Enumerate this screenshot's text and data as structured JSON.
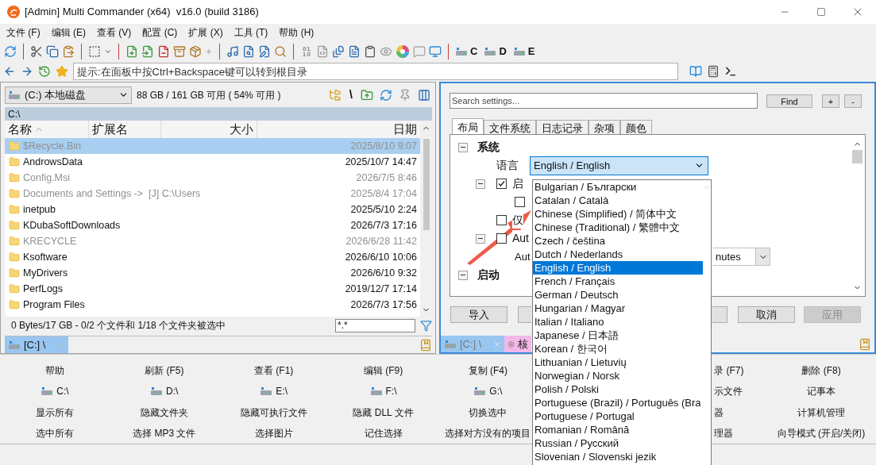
{
  "window": {
    "title": "[Admin] Multi Commander (x64)  v16.0 (build 3186)"
  },
  "menu": [
    "文件 (F)",
    "编辑 (E)",
    "查看 (V)",
    "配置 (C)",
    "扩展 (X)",
    "工具 (T)",
    "帮助 (H)"
  ],
  "toolbar_drives": [
    "C",
    "D",
    "E"
  ],
  "address": {
    "placeholder": "提示:在面板中按Ctrl+Backspace键可以转到根目录"
  },
  "left_panel": {
    "drive": "(C:) 本地磁盘",
    "space": "88 GB / 161 GB 可用 ( 54% 可用 )",
    "root_button": "\\",
    "path": "C:\\",
    "columns": [
      "名称",
      "扩展名",
      "大小",
      "日期"
    ],
    "rows": [
      {
        "name": "$Recycle.Bin",
        "date": "2025/8/10 9:07",
        "hidden": true,
        "selected": true
      },
      {
        "name": "AndrowsData",
        "date": "2025/10/7 14:47",
        "hidden": false,
        "selected": false
      },
      {
        "name": "Config.Msi",
        "date": "2026/7/5 8:46",
        "hidden": true,
        "selected": false
      },
      {
        "name": "Documents and Settings ->  [J] C:\\Users",
        "date": "2025/8/4 17:04",
        "hidden": true,
        "selected": false
      },
      {
        "name": "inetpub",
        "date": "2025/5/10 2:24",
        "hidden": false,
        "selected": false
      },
      {
        "name": "KDubaSoftDownloads",
        "date": "2026/7/3 17:16",
        "hidden": false,
        "selected": false
      },
      {
        "name": "KRECYCLE",
        "date": "2026/6/28 11:42",
        "hidden": true,
        "selected": false
      },
      {
        "name": "Ksoftware",
        "date": "2026/6/10 10:06",
        "hidden": false,
        "selected": false
      },
      {
        "name": "MyDrivers",
        "date": "2026/6/10 9:32",
        "hidden": false,
        "selected": false
      },
      {
        "name": "PerfLogs",
        "date": "2019/12/7 17:14",
        "hidden": false,
        "selected": false
      },
      {
        "name": "Program Files",
        "date": "2026/7/3 17:56",
        "hidden": false,
        "selected": false
      }
    ],
    "status": "0 Bytes/17 GB - 0/2 个文件和 1/18 个文件夹被选中",
    "filter": "*.*",
    "tabs": [
      {
        "label": "[C:] \\",
        "selected": true
      }
    ]
  },
  "settings": {
    "search_placeholder": "Search settings...",
    "find": "Find",
    "expand_all": "+",
    "collapse_all": "-",
    "tabs": [
      {
        "label": "布局",
        "selected": true
      },
      {
        "label": "文件系统",
        "selected": false
      },
      {
        "label": "日志记录",
        "selected": false
      },
      {
        "label": "杂项",
        "selected": false
      },
      {
        "label": "颜色",
        "selected": false
      }
    ],
    "tree": [
      {
        "label": "系统",
        "expanded": true,
        "children": [
          {
            "kind": "combo",
            "label": "语言",
            "value": "English / English",
            "open": true,
            "options": [
              {
                "label": "Bulgarian / Български",
                "selected": false
              },
              {
                "label": "Catalan / Català",
                "selected": false
              },
              {
                "label": "Chinese (Simplified) / 简体中文",
                "selected": false
              },
              {
                "label": "Chinese (Traditional) / 繁體中文",
                "selected": false
              },
              {
                "label": "Czech / čeština",
                "selected": false
              },
              {
                "label": "Dutch / Nederlands",
                "selected": false
              },
              {
                "label": "English / English",
                "selected": true
              },
              {
                "label": "French / Français",
                "selected": false
              },
              {
                "label": "German / Deutsch",
                "selected": false
              },
              {
                "label": "Hungarian / Magyar",
                "selected": false
              },
              {
                "label": "Italian / Italiano",
                "selected": false
              },
              {
                "label": "Japanese / 日本語",
                "selected": false
              },
              {
                "label": "Korean / 한국어",
                "selected": false
              },
              {
                "label": "Lithuanian / Lietuvių",
                "selected": false
              },
              {
                "label": "Norwegian / Norsk",
                "selected": false
              },
              {
                "label": "Polish / Polski",
                "selected": false
              },
              {
                "label": "Portuguese (Brazil) / Português (Bra",
                "selected": false
              },
              {
                "label": "Portuguese / Portugal",
                "selected": false
              },
              {
                "label": "Romanian / Română",
                "selected": false
              },
              {
                "label": "Russian / Русский",
                "selected": false
              },
              {
                "label": "Slovenian / Slovenski jezik",
                "selected": false
              }
            ]
          },
          {
            "kind": "check",
            "label": "启",
            "checked": true,
            "expanded": true,
            "children": [
              {
                "kind": "check",
                "checked": false
              }
            ]
          },
          {
            "kind": "check",
            "label": "仅",
            "checked": false
          },
          {
            "kind": "check",
            "label": "Aut",
            "checked": false,
            "expanded": true,
            "children": [
              {
                "kind": "select",
                "label": "Aut",
                "value": "nutes"
              }
            ]
          }
        ]
      },
      {
        "label": "启动",
        "expanded": true
      }
    ],
    "buttons": [
      {
        "label": "导入",
        "disabled": false
      },
      {
        "label": "取消",
        "disabled": false
      },
      {
        "label": "应用",
        "disabled": true
      }
    ],
    "tabs_bottom": [
      {
        "label": "[C:] \\",
        "kind": "drive",
        "selected": false
      },
      {
        "label": "核",
        "kind": "settings",
        "selected": true
      }
    ]
  },
  "button_grid": [
    [
      {
        "label": "帮助",
        "kind": "text"
      },
      {
        "label": "C:\\",
        "kind": "drive"
      },
      {
        "label": "显示所有",
        "kind": "text"
      },
      {
        "label": "选中所有",
        "kind": "text"
      }
    ],
    [
      {
        "label": "刷新 (F5)",
        "kind": "text"
      },
      {
        "label": "D:\\",
        "kind": "drive"
      },
      {
        "label": "隐藏文件夹",
        "kind": "text"
      },
      {
        "label": "选择 MP3 文件",
        "kind": "text"
      }
    ],
    [
      {
        "label": "查看 (F1)",
        "kind": "text"
      },
      {
        "label": "E:\\",
        "kind": "drive"
      },
      {
        "label": "隐藏可执行文件",
        "kind": "text"
      },
      {
        "label": "选择图片",
        "kind": "text"
      }
    ],
    [
      {
        "label": "编辑 (F9)",
        "kind": "text"
      },
      {
        "label": "F:\\",
        "kind": "drive"
      },
      {
        "label": "隐藏 DLL 文件",
        "kind": "text"
      },
      {
        "label": "记住选择",
        "kind": "text"
      }
    ],
    [
      {
        "label": "复制 (F4)",
        "kind": "text"
      },
      {
        "label": "G:\\",
        "kind": "drive"
      },
      {
        "label": "切换选中",
        "kind": "text"
      },
      {
        "label": "选择对方没有的项目",
        "kind": "text"
      }
    ],
    [
      {
        "label": "录 (F7)",
        "kind": "text"
      },
      {
        "label": "示文件",
        "kind": "text"
      },
      {
        "label": "器",
        "kind": "text"
      },
      {
        "label": "理器",
        "kind": "text"
      }
    ],
    [
      {
        "label": "删除 (F8)",
        "kind": "text"
      },
      {
        "label": "记事本",
        "kind": "text"
      },
      {
        "label": "计算机管理",
        "kind": "text"
      },
      {
        "label": "向导模式 (开启/关闭)",
        "kind": "text"
      }
    ]
  ]
}
